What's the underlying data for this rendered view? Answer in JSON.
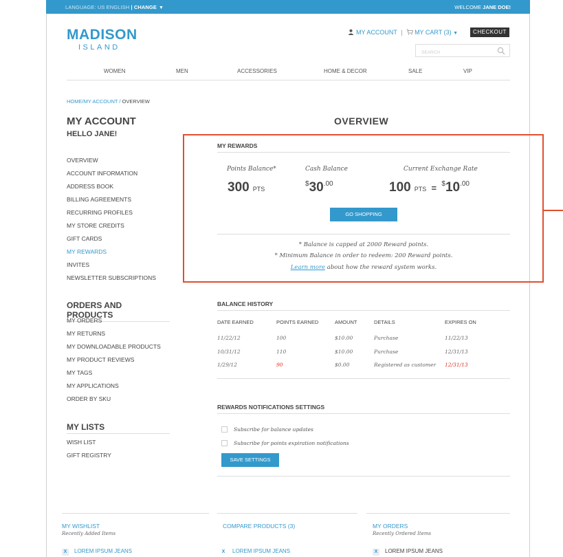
{
  "topbar": {
    "language_label": "LANGUAGE: US ENGLISH",
    "change_label": "CHANGE",
    "welcome_prefix": "WELCOME",
    "welcome_name": "JANE DOE!"
  },
  "logo": {
    "main": "MADISON",
    "sub": "ISLAND"
  },
  "header": {
    "my_account": "MY ACCOUNT",
    "my_cart": "MY CART (3)",
    "checkout": "CHECKOUT",
    "search_placeholder": "SEARCH"
  },
  "nav": [
    "WOMEN",
    "MEN",
    "ACCESSORIES",
    "HOME & DECOR",
    "SALE",
    "VIP"
  ],
  "breadcrumb": {
    "home": "HOME",
    "account": "MY ACCOUNT",
    "current": "OVERVIEW"
  },
  "sidebar": {
    "title": "MY ACCOUNT",
    "greeting": "HELLO JANE!",
    "account_items": [
      "OVERVIEW",
      "ACCOUNT INFORMATION",
      "ADDRESS BOOK",
      "BILLING AGREEMENTS",
      "RECURRING PROFILES",
      "MY STORE CREDITS",
      "GIFT CARDS",
      "MY REWARDS",
      "INVITES",
      "NEWSLETTER SUBSCRIPTIONS"
    ],
    "orders_title": "ORDERS AND PRODUCTS",
    "orders_items": [
      "MY ORDERS",
      "MY RETURNS",
      "MY DOWNLOADABLE PRODUCTS",
      "MY PRODUCT REVIEWS",
      "MY TAGS",
      "MY APPLICATIONS",
      "ORDER BY SKU"
    ],
    "lists_title": "MY LISTS",
    "lists_items": [
      "WISH LIST",
      "GIFT REGISTRY"
    ]
  },
  "main": {
    "title": "OVERVIEW",
    "rewards": {
      "heading": "MY REWARDS",
      "points_label": "Points Balance*",
      "points_value": "300",
      "points_unit": "PTS",
      "cash_label": "Cash Balance",
      "cash_currency": "$",
      "cash_value": "30",
      "cash_cents": ".00",
      "rate_label": "Current Exchange Rate",
      "rate_points": "100",
      "rate_unit": "PTS",
      "rate_equals": "=",
      "rate_currency": "$",
      "rate_value": "10",
      "rate_cents": ".00",
      "go_shopping": "GO SHOPPING",
      "note1": "* Balance is capped at 2000 Reward points.",
      "note2": "* Minimum Balance in order to redeem: 200 Reward points.",
      "learn_more": "Learn more",
      "note3_rest": " about how the reward system works."
    },
    "balance_history": {
      "heading": "BALANCE HISTORY",
      "columns": [
        "DATE EARNED",
        "POINTS EARNED",
        "AMOUNT",
        "DETAILS",
        "EXPIRES ON"
      ],
      "rows": [
        [
          "11/22/12",
          "100",
          "$10.00",
          "Purchase",
          "11/22/13"
        ],
        [
          "10/31/12",
          "110",
          "$10.00",
          "Purchase",
          "12/31/13"
        ],
        [
          "1/29/12",
          "90",
          "$0.00",
          "Registered as customer",
          "12/31/13"
        ]
      ]
    },
    "notifications": {
      "heading": "REWARDS NOTIFICATIONS SETTINGS",
      "opt1": "Subscribe for balance updates",
      "opt2": "Subscribe for points expiration notifications",
      "save": "SAVE SETTINGS"
    }
  },
  "footer": {
    "wishlist": {
      "title": "MY WISHLIST",
      "sub": "Recently Added Items",
      "item": "LOREM IPSUM JEANS"
    },
    "compare": {
      "title": "COMPARE PRODUCTS (3)",
      "item": "LOREM IPSUM JEANS"
    },
    "orders": {
      "title": "MY ORDERS",
      "sub": "Recently Ordered Items",
      "item": "LOREM IPSUM JEANS"
    }
  },
  "colors": {
    "accent": "#3399cc",
    "highlight": "#e04f2e",
    "alert": "#e03020"
  }
}
